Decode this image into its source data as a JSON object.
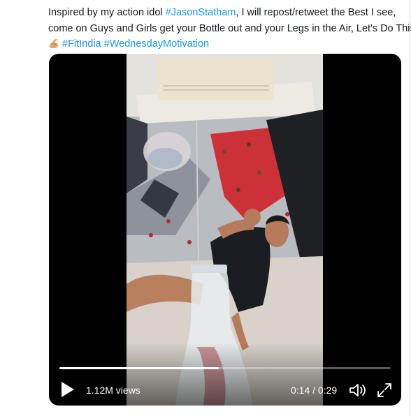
{
  "tweet": {
    "line1_prefix": "Inspired by my action idol ",
    "hashtag_jason": "#JasonStatham",
    "line1_suffix": ", I will repost/retweet the Best I see,",
    "line2": "come on Guys and Girls get your Bottle out and your Legs in the Air, Let's Do This",
    "emoji_icon": "flexed-biceps-icon",
    "hashtag_fitindia": "#FitIndia",
    "hashtag_wednesday": "#WednesdayMotivation"
  },
  "video": {
    "views": "1.12M views",
    "time": "0:14 / 0:29",
    "progress": 0.48,
    "icons": {
      "play": "play-icon",
      "volume": "volume-icon",
      "fullscreen": "fullscreen-icon"
    }
  },
  "colors": {
    "link": "#1b95e0",
    "text": "#14171a",
    "wall_red": "#c8303a"
  }
}
